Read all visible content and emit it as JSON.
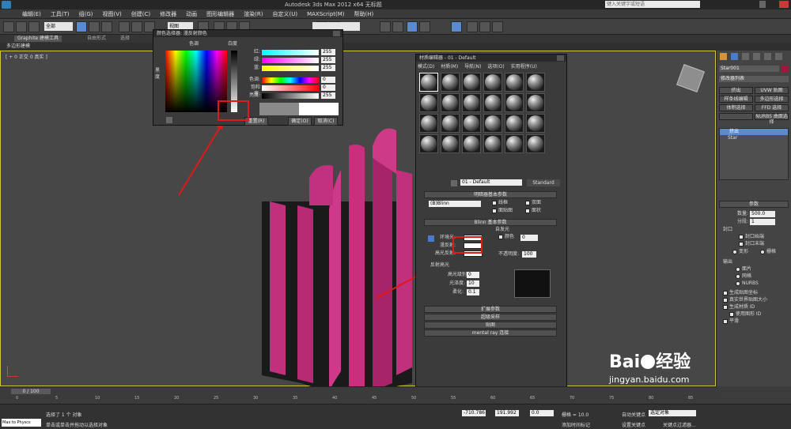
{
  "window": {
    "title": "Autodesk 3ds Max  2012 x64    无标题",
    "search_placeholder": "键入关键字或短语"
  },
  "menu": [
    "编辑(E)",
    "工具(T)",
    "组(G)",
    "视图(V)",
    "创建(C)",
    "修改器",
    "动画",
    "图形编辑器",
    "渲染(R)",
    "自定义(U)",
    "MAXScript(M)",
    "帮助(H)"
  ],
  "toolbar": {
    "selection_filter": "全部",
    "view_mode": "视图"
  },
  "ribbon": {
    "tabs": [
      "Graphite 建模工具",
      "自由形式",
      "选择"
    ],
    "sub": "多边形建模"
  },
  "viewport": {
    "label": "[ + 0 正交 0 真实 ]"
  },
  "color_picker": {
    "title": "颜色选择器: 漫反射颜色",
    "hue_label": "色调",
    "black_label": "黑度",
    "white_label": "白度",
    "channels": [
      {
        "label": "红:",
        "value": "255"
      },
      {
        "label": "绿:",
        "value": "255"
      },
      {
        "label": "蓝:",
        "value": "255"
      },
      {
        "label": "色调:",
        "value": "0"
      },
      {
        "label": "饱和度:",
        "value": "0"
      },
      {
        "label": "亮度:",
        "value": "255"
      }
    ],
    "reset_label": "重置(R)",
    "ok_label": "确定(O)",
    "cancel_label": "取消(C)"
  },
  "material_editor": {
    "title": "材质编辑器 - 01 - Default",
    "menu": [
      "模式(D)",
      "材质(M)",
      "导航(N)",
      "选项(O)",
      "实用程序(U)"
    ],
    "material_name": "01 - Default",
    "material_type": "Standard",
    "shader_rollout": "明暗器基本参数",
    "shader": "(B)Blinn",
    "shader_options": [
      "线框",
      "双面",
      "面贴图",
      "面状"
    ],
    "blinn_rollout": "Blinn 基本参数",
    "self_illum": "自发光",
    "self_illum_color": "颜色",
    "self_illum_value": "0",
    "ambient": "环境光:",
    "diffuse": "漫反射:",
    "specular": "高光反射:",
    "opacity_label": "不透明度:",
    "opacity_value": "100",
    "spec_highlights": "反射高光",
    "spec_level": "高光级别:",
    "spec_level_value": "0",
    "glossiness": "光泽度:",
    "glossiness_value": "10",
    "soften": "柔化:",
    "soften_value": "0.1",
    "rollouts": [
      "扩展参数",
      "超级采样",
      "贴图",
      "mental ray 连接"
    ]
  },
  "command_panel": {
    "object_name": "Star001",
    "modifier_list": "修改器列表",
    "buttons": [
      "挤出",
      "UVW 贴图",
      "样条线编辑",
      "多边形选择",
      "体积选择",
      "FFD 选择",
      "",
      "NURBS 曲面选择"
    ],
    "stack": [
      "挤出",
      "Star"
    ],
    "params_title": "参数",
    "amount_label": "数量:",
    "amount_value": "500.0",
    "segments_label": "分段:",
    "segments_value": "1",
    "capping": "封口",
    "cap_start": "封口始端",
    "cap_end": "封口末端",
    "morph": "变形",
    "grid": "栅格",
    "output": "输出",
    "out_patch": "面片",
    "out_mesh": "网格",
    "out_nurbs": "NURBS",
    "gen_map_coords": "生成贴图坐标",
    "real_world": "真实世界贴图大小",
    "gen_mat_ids": "生成材质 ID",
    "use_shape_ids": "使用图形 ID",
    "smooth": "平滑"
  },
  "timeline": {
    "frame": "0 / 100",
    "ticks": [
      "0",
      "5",
      "10",
      "15",
      "20",
      "25",
      "30",
      "35",
      "40",
      "45",
      "50",
      "55",
      "60",
      "65",
      "70",
      "75",
      "80",
      "85"
    ]
  },
  "status": {
    "script_label": "Max to Physcs",
    "line1": "选择了 1 个 对象",
    "line2": "单击或单击并拖动以选择对象",
    "x_value": "-710.786",
    "y_value": "191.992",
    "z_value": "0.0",
    "grid_label": "栅格 = 10.0",
    "auto_key": "自动关键点",
    "set_key": "设置关键点",
    "selection_set": "选定对象",
    "key_filter": "关键点过滤器...",
    "add_time_tag": "添加时间标记"
  },
  "watermark": {
    "brand": "Bai",
    "brand2": "经验",
    "url": "jingyan.baidu.com"
  },
  "colors": {
    "object": "#c0307c",
    "accent": "#d8c838",
    "arrow": "#e01818"
  }
}
